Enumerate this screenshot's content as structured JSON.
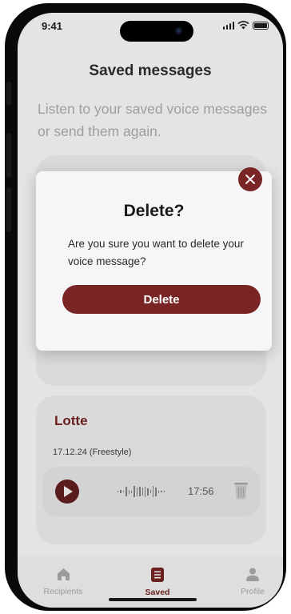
{
  "status_bar": {
    "time": "9:41"
  },
  "page": {
    "title": "Saved messages",
    "subtitle": "Listen to your saved voice messages or send them again."
  },
  "message_card": {
    "name": "Lotte",
    "date_line": "17.12.24 (Freestyle)",
    "duration": "17:56"
  },
  "dialog": {
    "title": "Delete?",
    "body": "Are you sure you want to delete your voice message?",
    "confirm_label": "Delete"
  },
  "tabbar": {
    "items": [
      {
        "label": "Recipients",
        "icon": "home-icon",
        "active": false
      },
      {
        "label": "Saved",
        "icon": "saved-icon",
        "active": true
      },
      {
        "label": "Profile",
        "icon": "profile-icon",
        "active": false
      }
    ]
  },
  "colors": {
    "accent": "#7a2525",
    "overlay_background": "#e4e4e4",
    "dialog_background": "#f6f6f8"
  }
}
